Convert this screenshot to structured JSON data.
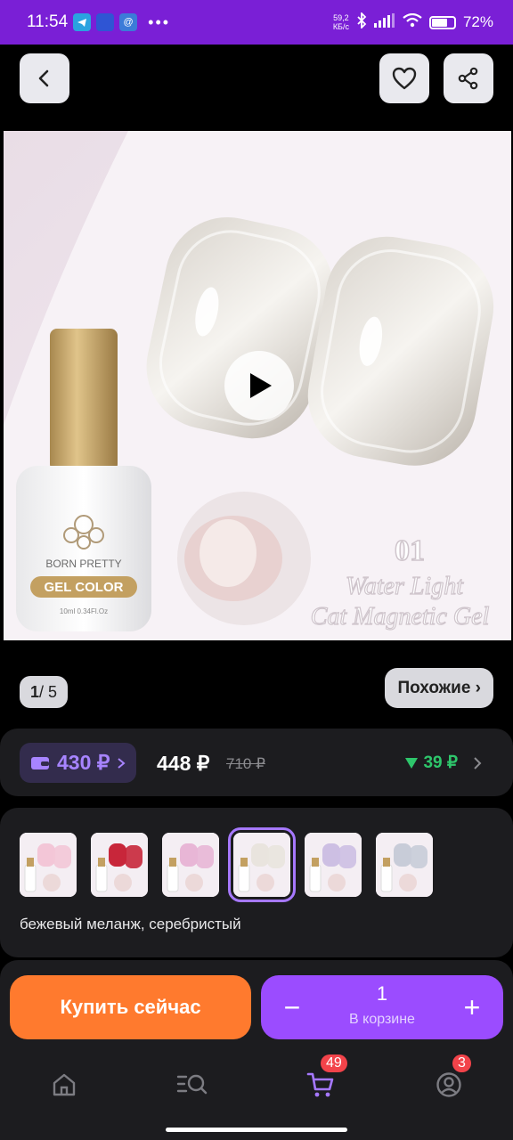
{
  "status_bar": {
    "time": "11:54",
    "speed_value": "59,2",
    "speed_unit": "КБ/с",
    "battery": "72%",
    "battery_level": 0.72
  },
  "nav": {
    "back_icon": "chevron-left-icon",
    "favorite_icon": "heart-icon",
    "share_icon": "share-icon"
  },
  "gallery": {
    "product_brand": "BORN PRETTY",
    "product_line": "GEL COLOR",
    "bottle_volume": "10ml 0.34Fl.Oz",
    "shade_number": "01",
    "caption_line1": "Water Light",
    "caption_line2": "Cat Magnetic Gel",
    "current": "1",
    "total": "/ 5",
    "similar_label": "Похожие ›"
  },
  "price": {
    "wallet_price": "430 ₽",
    "main_price": "448 ₽",
    "old_price": "710 ₽",
    "cashback": "39 ₽"
  },
  "variants": {
    "colors": [
      "#f3c6d7",
      "#c8263a",
      "#e8b6d6",
      "#e9e4de",
      "#cdbfe3",
      "#c8ccd8"
    ],
    "selected_index": 3,
    "selected_label": "бежевый меланж, серебристый"
  },
  "actions": {
    "buy_label": "Купить сейчас",
    "quantity": "1",
    "in_cart_label": "В корзине",
    "minus": "−",
    "plus": "+"
  },
  "tabs": {
    "cart_badge": "49",
    "profile_badge": "3"
  },
  "colors": {
    "status_bar": "#7a1fd6",
    "accent_purple": "#9b4cff",
    "buy_orange": "#ff7a2e",
    "cashback_green": "#2ec66b"
  }
}
